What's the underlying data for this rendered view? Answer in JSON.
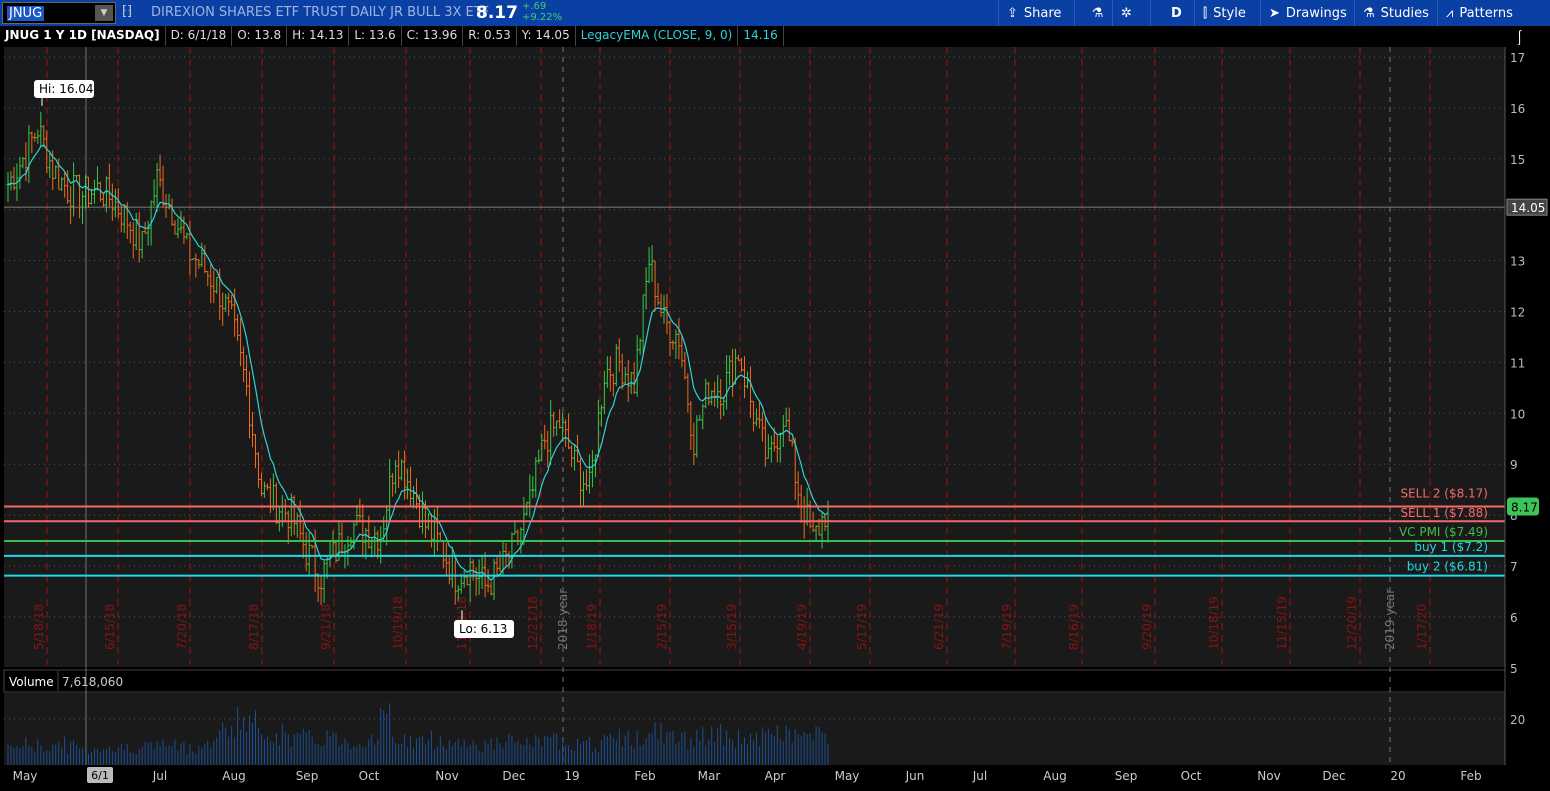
{
  "header": {
    "symbol": "JNUG",
    "company": "DIREXION SHARES ETF TRUST DAILY JR BULL 3X ETF",
    "last": "8.17",
    "change": "+.69",
    "change_pct": "+9.22%",
    "buttons": [
      {
        "label": "Share",
        "icon": "share-icon"
      },
      {
        "label": "",
        "icon": "flask-icon"
      },
      {
        "label": "",
        "icon": "gear-icon"
      },
      {
        "label": "D",
        "icon": ""
      },
      {
        "label": "Style",
        "icon": "candle-icon"
      },
      {
        "label": "Drawings",
        "icon": "cursor-icon"
      },
      {
        "label": "Studies",
        "icon": "flask-icon"
      },
      {
        "label": "Patterns",
        "icon": "patterns-icon"
      }
    ]
  },
  "info": {
    "title": "JNUG 1 Y 1D [NASDAQ]",
    "date": "D: 6/1/18",
    "open": "O: 13.8",
    "high": "H: 14.13",
    "low": "L: 13.6",
    "close": "C: 13.96",
    "range": "R: 0.53",
    "y": "Y: 14.05",
    "study": "LegacyEMA (CLOSE, 9, 0)",
    "study_value": "14.16"
  },
  "chart_data": {
    "type": "ohlc",
    "symbol": "JNUG",
    "ylim": [
      5,
      17
    ],
    "yticks": [
      5,
      6,
      7,
      8,
      9,
      10,
      11,
      12,
      13,
      14,
      15,
      16,
      17
    ],
    "weekly_close": [
      14.5,
      15.0,
      15.6,
      14.8,
      14.4,
      14.3,
      14.4,
      14.2,
      13.8,
      13.3,
      14.6,
      14.0,
      13.2,
      12.9,
      12.5,
      11.8,
      10.5,
      8.5,
      8.2,
      8.0,
      7.3,
      6.8,
      7.3,
      7.8,
      7.7,
      7.6,
      9.2,
      8.6,
      7.8,
      7.4,
      6.8,
      7.0,
      6.6,
      6.9,
      7.4,
      8.2,
      9.5,
      9.8,
      9.0,
      8.5,
      10.8,
      11.0,
      10.6,
      13.0,
      11.8,
      11.5,
      9.5,
      10.5,
      10.5,
      11.2,
      10.0,
      9.0,
      10.0,
      8.5,
      7.5,
      8.17
    ],
    "hi_label": "Hi: 16.04",
    "lo_label": "Lo: 6.13",
    "crosshair_price": "14.05",
    "last_price": "8.17",
    "levels": [
      {
        "label": "SELL 2 ($8.17)",
        "price": 8.17,
        "color": "#f26b6b"
      },
      {
        "label": "SELL 1 ($7.88)",
        "price": 7.88,
        "color": "#f26b6b"
      },
      {
        "label": "VC PMI ($7.49)",
        "price": 7.49,
        "color": "#3cbf4a"
      },
      {
        "label": "buy 1 ($7.2)",
        "price": 7.2,
        "color": "#1fd9e6"
      },
      {
        "label": "buy 2 ($6.81)",
        "price": 6.81,
        "color": "#1fd9e6"
      }
    ],
    "expiry_dates": [
      "5/18/18",
      "6/15/18",
      "7/20/18",
      "8/17/18",
      "9/21/18",
      "10/19/18",
      "11/16/18",
      "12/21/18",
      "1/18/19",
      "2/15/19",
      "3/15/19",
      "4/19/19",
      "5/17/19",
      "6/21/19",
      "7/19/19",
      "8/16/19",
      "9/20/19",
      "10/18/19",
      "11/15/19",
      "12/20/19",
      "1/17/20"
    ],
    "year_markers": [
      "2018 year",
      "2019 year"
    ],
    "months": [
      "May",
      "Jul",
      "Aug",
      "Sep",
      "Oct",
      "Nov",
      "Dec",
      "19",
      "Feb",
      "Mar",
      "Apr",
      "May",
      "Jun",
      "Jul",
      "Aug",
      "Sep",
      "Oct",
      "Nov",
      "Dec",
      "20",
      "Feb"
    ],
    "cursor_date": "6/1",
    "volume": {
      "label": "Volume",
      "value": "7,618,060",
      "ytick": "20",
      "weekly_millions": [
        8,
        9,
        8,
        9,
        8,
        7,
        8,
        7,
        8,
        8,
        9,
        8,
        8,
        9,
        14,
        20,
        17,
        15,
        13,
        12,
        11,
        12,
        11,
        10,
        12,
        20,
        11,
        10,
        11,
        10,
        10,
        9,
        9,
        10,
        9,
        10,
        10,
        11,
        10,
        9,
        10,
        12,
        11,
        14,
        12,
        11,
        12,
        13,
        11,
        12,
        12,
        13,
        14,
        12,
        13,
        12
      ]
    }
  }
}
